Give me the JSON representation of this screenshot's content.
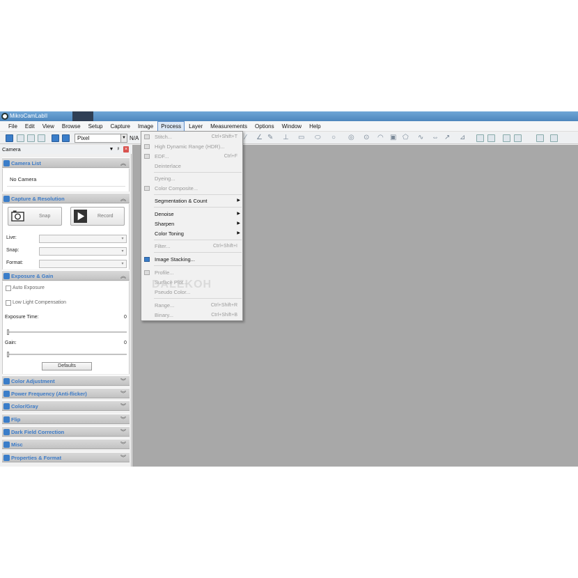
{
  "window": {
    "title": "MikroCamLabII"
  },
  "menubar": {
    "items": [
      "File",
      "Edit",
      "View",
      "Browse",
      "Setup",
      "Capture",
      "Image",
      "Process",
      "Layer",
      "Measurements",
      "Options",
      "Window",
      "Help"
    ],
    "active": "Process"
  },
  "toolbar": {
    "unit_value": "Pixel",
    "na_label": "N/A"
  },
  "camera_panel": {
    "title": "Camera",
    "sections": {
      "camera_list": {
        "title": "Camera List",
        "item": "No Camera"
      },
      "capture_resolution": {
        "title": "Capture & Resolution",
        "snap_label": "Snap",
        "record_label": "Record",
        "live_label": "Live:",
        "snap_field_label": "Snap:",
        "format_label": "Format:"
      },
      "exposure_gain": {
        "title": "Exposure & Gain",
        "auto_exposure_label": "Auto Exposure",
        "low_light_label": "Low Light Compensation",
        "exposure_time_label": "Exposure Time:",
        "exposure_time_value": "0",
        "gain_label": "Gain:",
        "gain_value": "0",
        "defaults_label": "Defaults"
      },
      "collapsed": [
        "Color Adjustment",
        "Power Frequency (Anti-flicker)",
        "Color/Gray",
        "Flip",
        "Dark Field Correction",
        "Misc",
        "Properties & Format"
      ]
    }
  },
  "process_menu": {
    "items": [
      {
        "label": "Stitch...",
        "shortcut": "Ctrl+Shift+T",
        "disabled": true,
        "icon": "stitch-icon"
      },
      {
        "label": "High Dynamic Range (HDR)...",
        "shortcut": "",
        "disabled": true,
        "icon": "hdr-icon"
      },
      {
        "label": "EDF...",
        "shortcut": "Ctrl+F",
        "disabled": true,
        "icon": "edf-icon"
      },
      {
        "label": "Deinterlace",
        "shortcut": "",
        "disabled": true,
        "icon": ""
      },
      {
        "separator": true
      },
      {
        "label": "Dyeing...",
        "shortcut": "",
        "disabled": true,
        "icon": ""
      },
      {
        "label": "Color Composite...",
        "shortcut": "",
        "disabled": true,
        "icon": "composite-icon"
      },
      {
        "separator": true
      },
      {
        "label": "Segmentation & Count",
        "shortcut": "",
        "disabled": false,
        "submenu": true
      },
      {
        "separator": true
      },
      {
        "label": "Denoise",
        "shortcut": "",
        "disabled": false,
        "submenu": true
      },
      {
        "label": "Sharpen",
        "shortcut": "",
        "disabled": false,
        "submenu": true
      },
      {
        "label": "Color Toning",
        "shortcut": "",
        "disabled": false,
        "submenu": true
      },
      {
        "separator": true
      },
      {
        "label": "Filter...",
        "shortcut": "Ctrl+Shift+I",
        "disabled": true
      },
      {
        "separator": true
      },
      {
        "label": "Image Stacking...",
        "shortcut": "",
        "disabled": false,
        "icon": "stacking-icon"
      },
      {
        "separator": true
      },
      {
        "label": "Profile...",
        "shortcut": "",
        "disabled": true,
        "icon": "profile-icon"
      },
      {
        "label": "Surface Plot...",
        "shortcut": "",
        "disabled": true
      },
      {
        "label": "Pseudo Color...",
        "shortcut": "",
        "disabled": true
      },
      {
        "separator": true
      },
      {
        "label": "Range...",
        "shortcut": "Ctrl+Shift+R",
        "disabled": true
      },
      {
        "label": "Binary...",
        "shortcut": "Ctrl+Shift+B",
        "disabled": true
      }
    ]
  },
  "watermark": "DALEKOH",
  "colors": {
    "accent": "#3a7dc9",
    "workspace": "#a8a8a8",
    "titlebar": "#5a93c9"
  }
}
